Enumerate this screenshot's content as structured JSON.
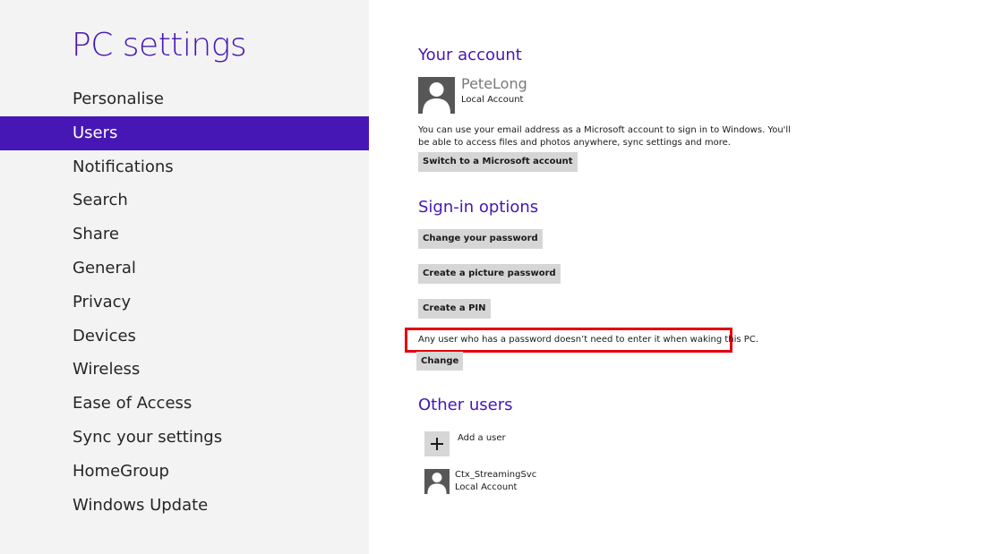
{
  "sidebar": {
    "title": "PC settings",
    "items": [
      {
        "label": "Personalise",
        "active": false
      },
      {
        "label": "Users",
        "active": true
      },
      {
        "label": "Notifications",
        "active": false
      },
      {
        "label": "Search",
        "active": false
      },
      {
        "label": "Share",
        "active": false
      },
      {
        "label": "General",
        "active": false
      },
      {
        "label": "Privacy",
        "active": false
      },
      {
        "label": "Devices",
        "active": false
      },
      {
        "label": "Wireless",
        "active": false
      },
      {
        "label": "Ease of Access",
        "active": false
      },
      {
        "label": "Sync your settings",
        "active": false
      },
      {
        "label": "HomeGroup",
        "active": false
      },
      {
        "label": "Windows Update",
        "active": false
      }
    ]
  },
  "account": {
    "section_title": "Your account",
    "user_name": "PeteLong",
    "account_type": "Local Account",
    "description": "You can use your email address as a Microsoft account to sign in to Windows. You'll be able to access files and photos anywhere, sync settings and more.",
    "switch_button": "Switch to a Microsoft account",
    "avatar_icon": "user-silhouette-icon"
  },
  "signin": {
    "section_title": "Sign-in options",
    "change_password_button": "Change your password",
    "picture_password_button": "Create a picture password",
    "pin_button": "Create a PIN",
    "wake_notice": "Any user who has a password doesn’t need to enter it when waking this PC.",
    "change_button": "Change"
  },
  "other_users": {
    "section_title": "Other users",
    "add_user_label": "Add a user",
    "add_user_icon": "plus-icon",
    "users": [
      {
        "name": "Ctx_StreamingSvc",
        "type": "Local Account"
      }
    ]
  },
  "colors": {
    "accent": "#4617b4",
    "sidebar_bg": "#f3f3f3",
    "button_bg": "#d6d6d6",
    "highlight": "#e3000b"
  }
}
